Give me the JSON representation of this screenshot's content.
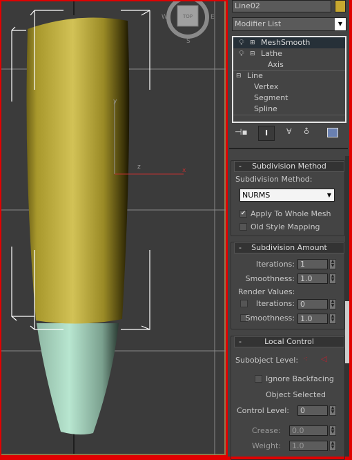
{
  "viewport": {
    "label": "TOP",
    "compass": {
      "w": "W",
      "e": "E",
      "s": "S"
    },
    "axes": {
      "x": "x",
      "y": "y",
      "z": "z"
    },
    "colors": {
      "body": "#c9b640",
      "tip": "#b4e4cc",
      "x_axis": "#c03030"
    }
  },
  "panel": {
    "object_name": "Line02",
    "object_color": "#c8a830",
    "modifier_list": "Modifier List",
    "stack": [
      {
        "label": "MeshSmooth",
        "selected": true
      },
      {
        "label": "Lathe"
      },
      {
        "label": "Axis"
      },
      {
        "label": "Line"
      },
      {
        "label": "Vertex"
      },
      {
        "label": "Segment"
      },
      {
        "label": "Spline"
      }
    ],
    "toolbar": [
      "pin-stack-icon",
      "show-end-result-icon",
      "make-unique-icon",
      "remove-modifier-icon",
      "configure-sets-icon"
    ],
    "subdivision_method": {
      "title": "Subdivision Method",
      "method_label": "Subdivision Method:",
      "method_value": "NURMS",
      "apply_whole_mesh": "Apply To Whole Mesh",
      "apply_checked": true,
      "old_style": "Old Style Mapping",
      "old_checked": false
    },
    "subdivision_amount": {
      "title": "Subdivision Amount",
      "iterations_label": "Iterations:",
      "iterations": "1",
      "smoothness_label": "Smoothness:",
      "smoothness": "1.0",
      "render_values": "Render Values:",
      "r_iterations_label": "Iterations:",
      "r_iterations": "0",
      "r_smoothness_label": "Smoothness:",
      "r_smoothness": "1.0"
    },
    "local_control": {
      "title": "Local Control",
      "subobject_label": "Subobject Level:",
      "ignore_backfacing": "Ignore Backfacing",
      "status": "Object Selected",
      "control_level_label": "Control Level:",
      "control_level": "0",
      "crease_label": "Crease:",
      "crease": "0.0",
      "weight_label": "Weight:",
      "weight": "1.0"
    },
    "collapse_symbol": "-"
  }
}
